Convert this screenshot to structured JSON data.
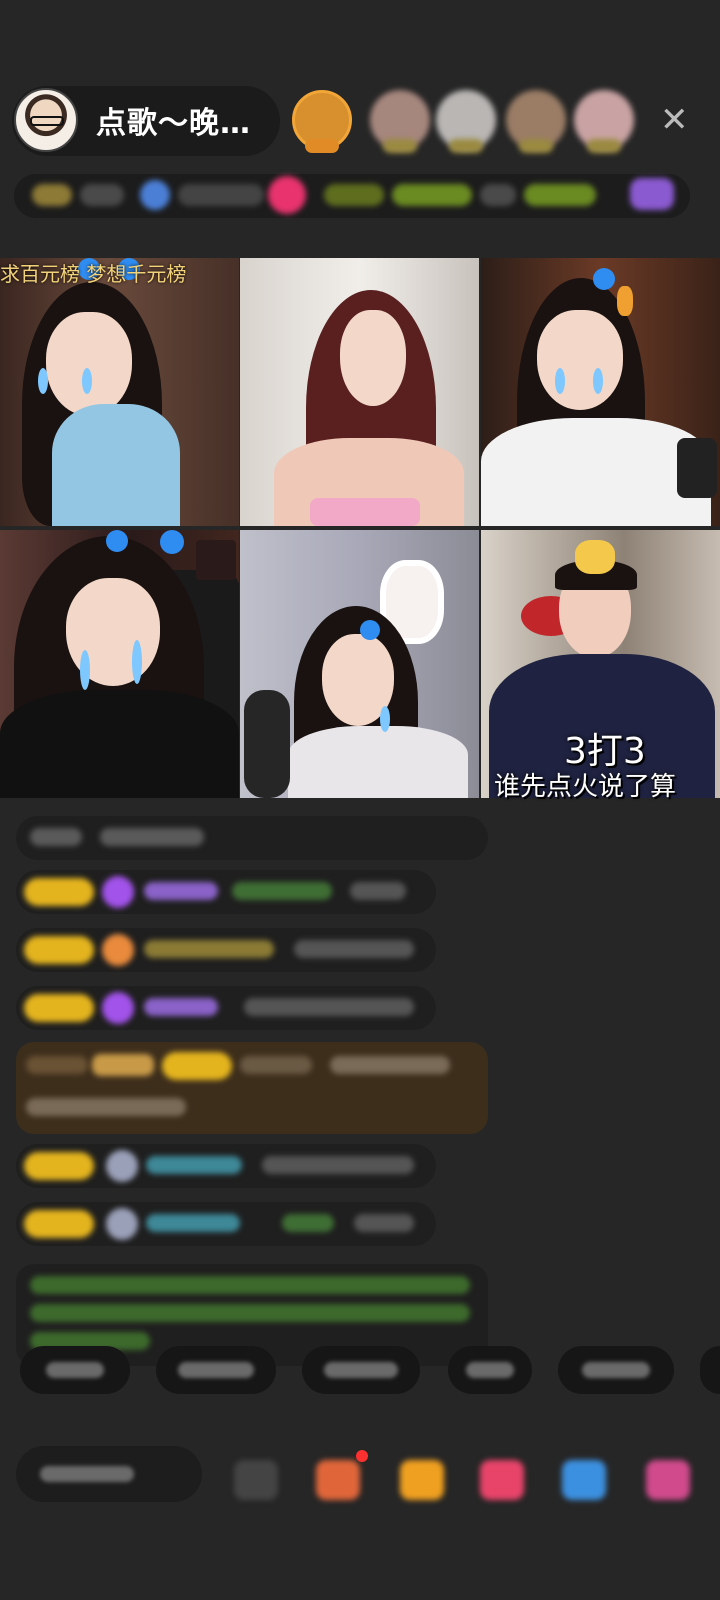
{
  "header": {
    "host_name": "点歌～晚…",
    "audience_count": 5,
    "close_icon": "close-icon"
  },
  "grid": {
    "tiles": [
      {
        "id": 1,
        "banner": "求百元榜 梦想千元榜"
      },
      {
        "id": 2,
        "banner": ""
      },
      {
        "id": 3,
        "banner": ""
      },
      {
        "id": 4,
        "banner": ""
      },
      {
        "id": 5,
        "banner": ""
      },
      {
        "id": 6,
        "overlay_title": "3打3",
        "overlay_subtitle": "谁先点火说了算"
      }
    ]
  },
  "colors": {
    "background": "#262626",
    "badge_gold": "#e4b41e",
    "chat_green": "#7bbf5e",
    "chat_blue": "#5fb6c9",
    "chat_purple": "#a46ee6"
  }
}
